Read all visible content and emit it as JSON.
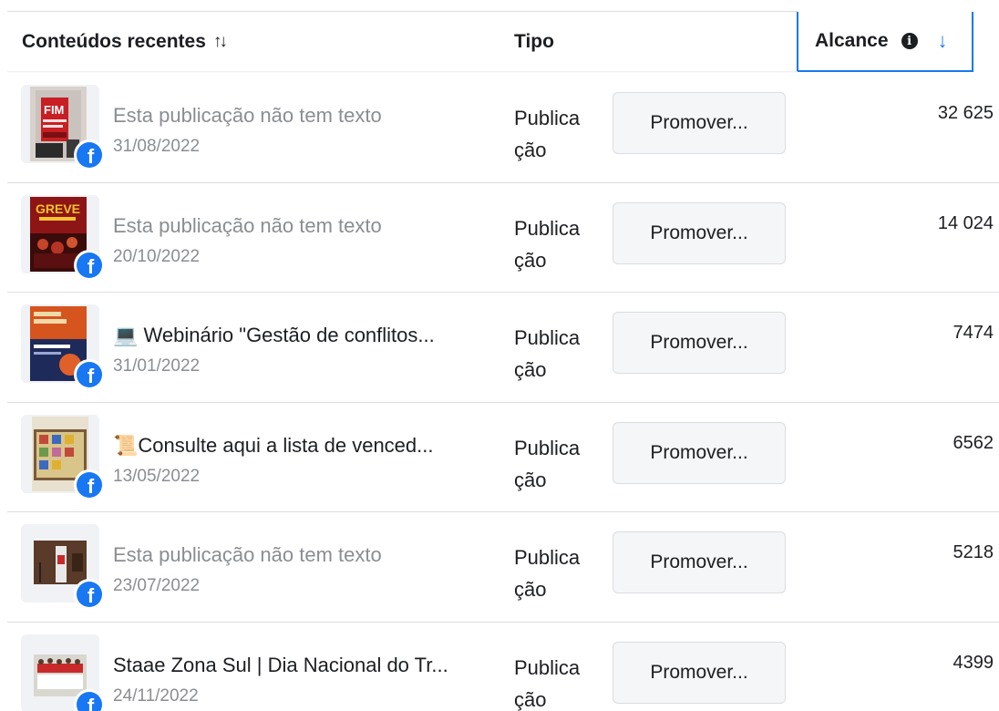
{
  "header": {
    "content_label": "Conteúdos recentes",
    "type_label": "Tipo",
    "reach_label": "Alcance",
    "sort_icon": "↑↓",
    "sorted_desc_icon": "↓"
  },
  "action_label": "Promover...",
  "type_line1": "Publica",
  "type_line2": "ção",
  "rows": [
    {
      "title": "Esta publicação não tem texto",
      "date": "31/08/2022",
      "reach": "32 625",
      "placeholder": true
    },
    {
      "title": "Esta publicação não tem texto",
      "date": "20/10/2022",
      "reach": "14 024",
      "placeholder": true
    },
    {
      "title": "💻 Webinário \"Gestão de conflitos...",
      "date": "31/01/2022",
      "reach": "7474",
      "placeholder": false
    },
    {
      "title": "📜Consulte aqui a lista de venced...",
      "date": "13/05/2022",
      "reach": "6562",
      "placeholder": false
    },
    {
      "title": "Esta publicação não tem texto",
      "date": "23/07/2022",
      "reach": "5218",
      "placeholder": true
    },
    {
      "title": "Staae Zona Sul | Dia Nacional do Tr...",
      "date": "24/11/2022",
      "reach": "4399",
      "placeholder": false
    }
  ],
  "thumbnail_text": {
    "row1": "FIM",
    "row2": "GREVE"
  },
  "colors": {
    "accent": "#1877f2",
    "muted_text": "#8a8d91",
    "button_bg": "#f5f6f7"
  }
}
